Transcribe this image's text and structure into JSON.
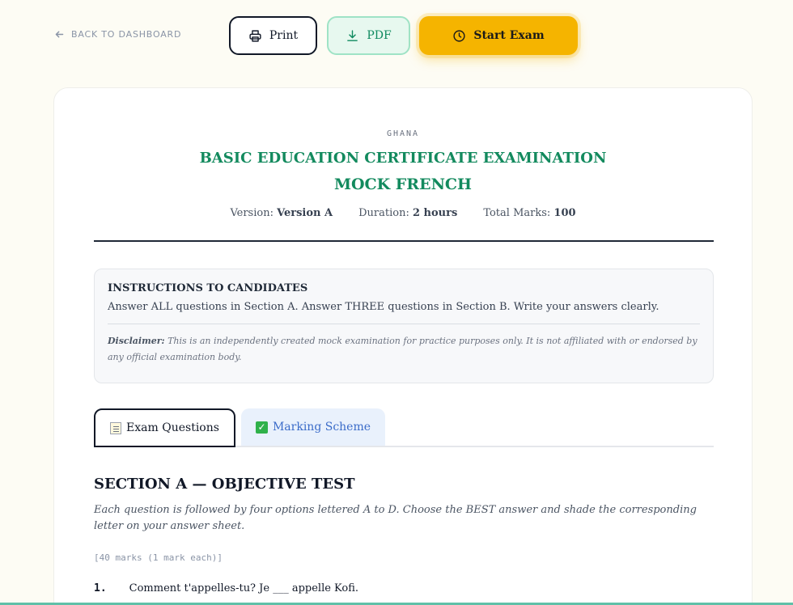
{
  "topbar": {
    "back_label": "BACK TO DASHBOARD",
    "print_label": "Print",
    "pdf_label": "PDF",
    "start_label": "Start Exam"
  },
  "exam": {
    "country": "GHANA",
    "title": "BASIC EDUCATION CERTIFICATE EXAMINATION",
    "subtitle": "MOCK FRENCH",
    "version_label": "Version:",
    "version_value": "Version A",
    "duration_label": "Duration:",
    "duration_value": "2 hours",
    "marks_label": "Total Marks:",
    "marks_value": "100"
  },
  "instructions": {
    "title": "INSTRUCTIONS TO CANDIDATES",
    "text": "Answer ALL questions in Section A. Answer THREE questions in Section B. Write your answers clearly.",
    "disclaimer_label": "Disclaimer:",
    "disclaimer_text": "This is an independently created mock examination for practice purposes only. It is not affiliated with or endorsed by any official examination body."
  },
  "tabs": {
    "exam_label": "Exam Questions",
    "marking_label": "Marking Scheme"
  },
  "section_a": {
    "title": "SECTION A — OBJECTIVE TEST",
    "description": "Each question is followed by four options lettered A to D. Choose the BEST answer and shade the corresponding letter on your answer sheet.",
    "marks_note": "[40 marks (1 mark each)]",
    "questions": [
      {
        "number": "1.",
        "text": "Comment t'appelles-tu? Je ___ appelle Kofi."
      }
    ]
  },
  "colors": {
    "accent_green": "#138a5e",
    "start_button": "#f5b400",
    "marking_tab": "#3b6cc9"
  }
}
